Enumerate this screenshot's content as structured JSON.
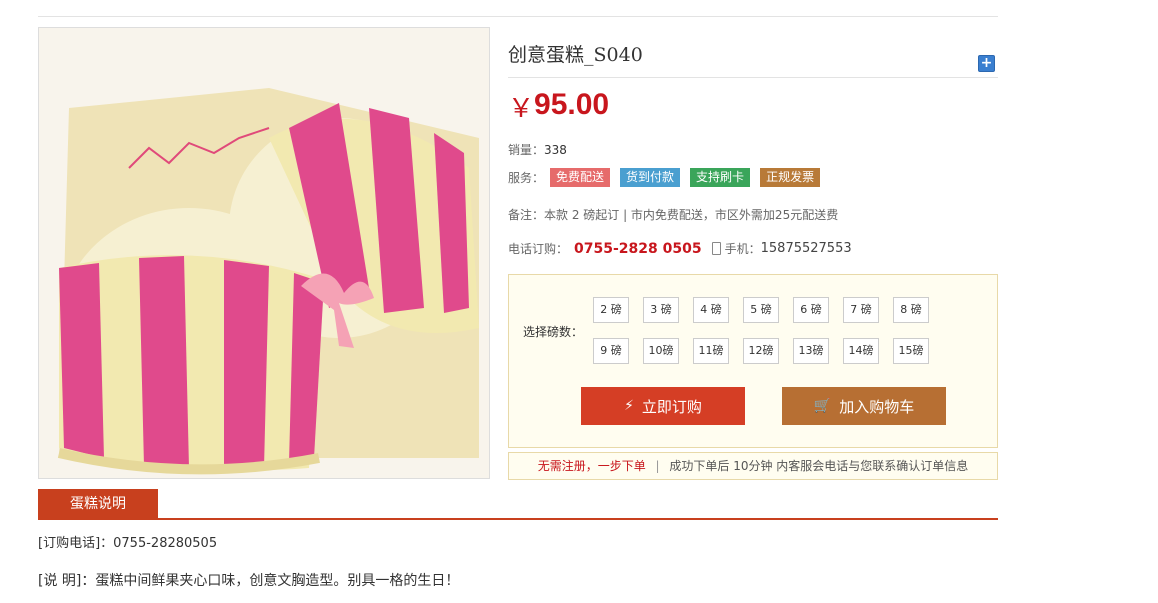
{
  "product": {
    "title": "创意蛋糕_S040",
    "price_symbol": "￥",
    "price": "95.00",
    "sold_label": "销量：",
    "sold_value": "338",
    "service_label": "服务：",
    "services": [
      {
        "label": "免费配送",
        "color": "#e66b6b"
      },
      {
        "label": "货到付款",
        "color": "#4a9fd0"
      },
      {
        "label": "支持刷卡",
        "color": "#3aa55a"
      },
      {
        "label": "正规发票",
        "color": "#b87a38"
      }
    ],
    "note": "备注：本款 2 磅起订 | 市内免费配送，市区外需加25元配送费",
    "phone_label": "电话订购：",
    "phone": "0755-2828 0505",
    "mobile_label": "手机：",
    "mobile": "15875527553"
  },
  "selector": {
    "label": "选择磅数：",
    "options": [
      "2 磅",
      "3 磅",
      "4 磅",
      "5 磅",
      "6 磅",
      "7 磅",
      "8 磅",
      "9 磅",
      "10磅",
      "11磅",
      "12磅",
      "13磅",
      "14磅",
      "15磅"
    ]
  },
  "actions": {
    "buy_label": "立即订购",
    "cart_label": "加入购物车"
  },
  "tip": {
    "highlight": "无需注册，一步下单",
    "rest": "成功下单后 10分钟 内客服会电话与您联系确认订单信息"
  },
  "description": {
    "tab_label": "蛋糕说明",
    "order_phone": "[订购电话]：0755-28280505",
    "detail": "[说 明]：蛋糕中间鲜果夹心口味，创意文胸造型。别具一格的生日！"
  },
  "colors": {
    "accent": "#c8161d",
    "tab": "#c8401e",
    "buy": "#d53e25",
    "cart": "#b76f33"
  }
}
